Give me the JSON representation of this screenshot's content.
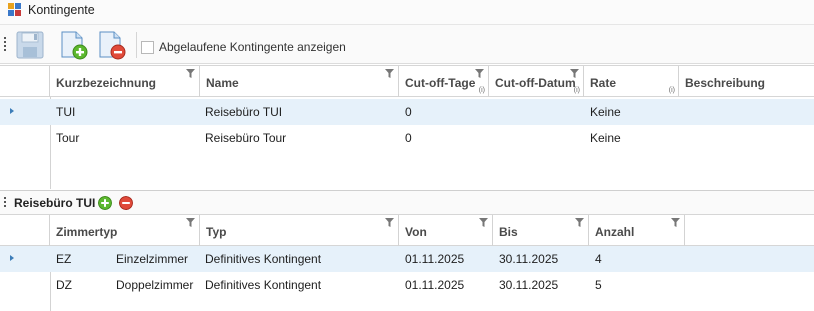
{
  "window": {
    "title": "Kontingente"
  },
  "toolbar": {
    "save_icon": "floppy-disk-icon",
    "add_icon": "document-add-icon",
    "remove_icon": "document-remove-icon",
    "show_expired_label": "Abgelaufene Kontingente anzeigen",
    "show_expired_checked": false
  },
  "grid1": {
    "columns": [
      "Kurzbezeichnung",
      "Name",
      "Cut-off-Tage",
      "Cut-off-Datum",
      "Rate",
      "Beschreibung"
    ],
    "info_marker": "(i)",
    "rows": [
      {
        "kurz": "TUI",
        "name": "Reisebüro TUI",
        "tage": "0",
        "datum": "",
        "rate": "Keine",
        "beschreibung": "",
        "selected": true
      },
      {
        "kurz": "Tour",
        "name": "Reisebüro Tour",
        "tage": "0",
        "datum": "",
        "rate": "Keine",
        "beschreibung": "",
        "selected": false
      }
    ]
  },
  "detail": {
    "title": "Reisebüro TUI",
    "add_icon": "green-plus-circle-icon",
    "remove_icon": "red-minus-circle-icon"
  },
  "grid2": {
    "columns": [
      "Zimmertyp",
      "Typ",
      "Von",
      "Bis",
      "Anzahl"
    ],
    "rows": [
      {
        "code": "EZ",
        "zimmer": "Einzelzimmer",
        "typ": "Definitives Kontingent",
        "von": "01.11.2025",
        "bis": "30.11.2025",
        "anzahl": "4",
        "selected": true
      },
      {
        "code": "DZ",
        "zimmer": "Doppelzimmer",
        "typ": "Definitives Kontingent",
        "von": "01.11.2025",
        "bis": "30.11.2025",
        "anzahl": "5",
        "selected": false
      }
    ]
  },
  "colors": {
    "selection": "#e6f1fa",
    "accent": "#3d7db8",
    "add": "#5cb82e",
    "remove": "#e04a3a"
  }
}
